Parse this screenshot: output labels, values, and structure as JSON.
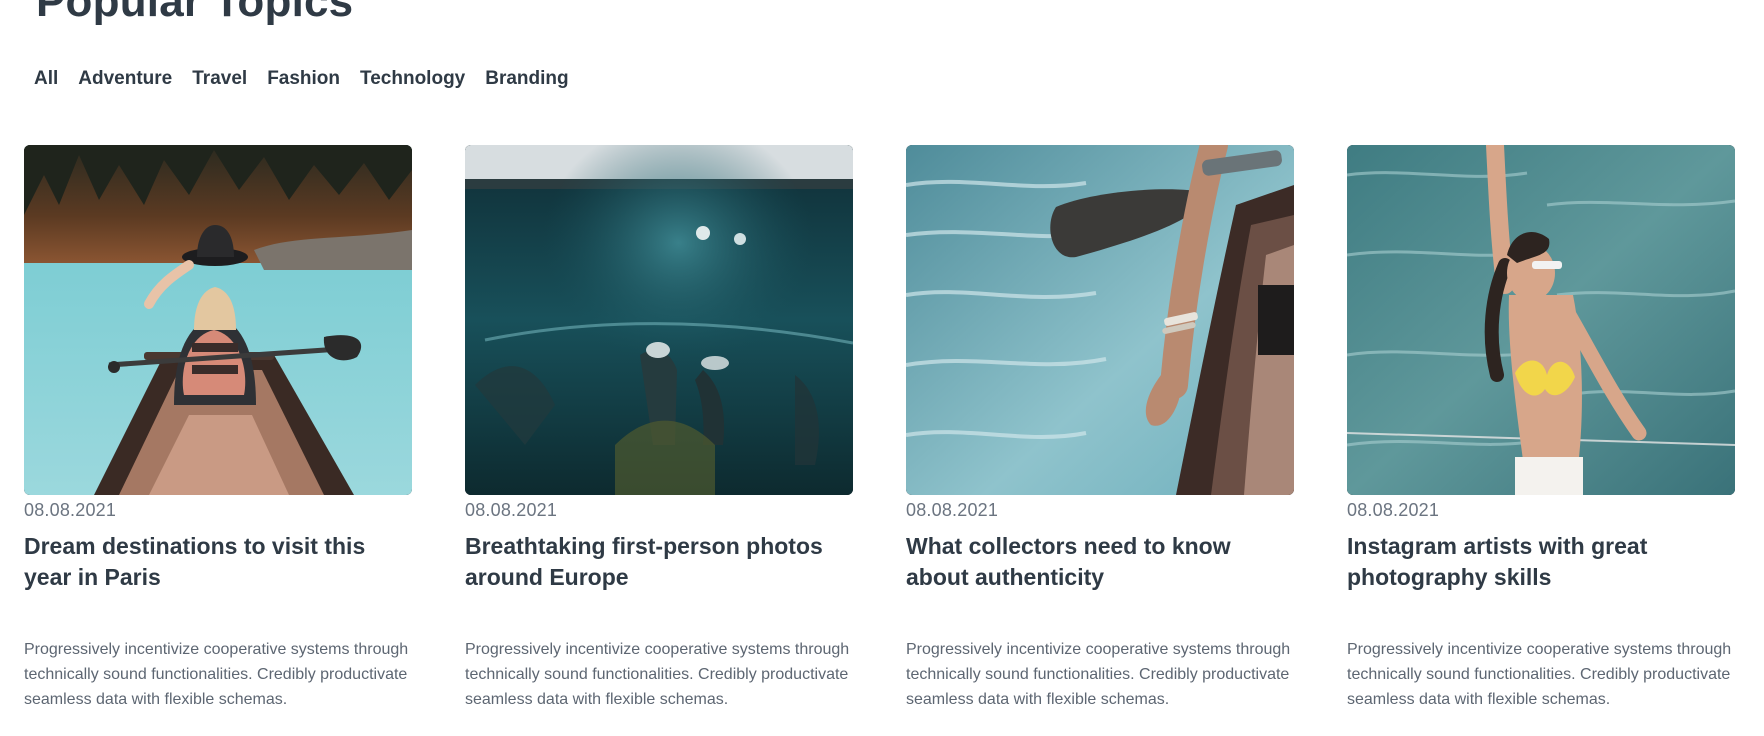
{
  "page": {
    "title": "Popular Topics"
  },
  "tabs": [
    {
      "label": "All"
    },
    {
      "label": "Adventure"
    },
    {
      "label": "Travel"
    },
    {
      "label": "Fashion"
    },
    {
      "label": "Technology"
    },
    {
      "label": "Branding"
    }
  ],
  "cards": [
    {
      "date": "08.08.2021",
      "title": "Dream destinations to visit this year in Paris",
      "excerpt": "Progressively incentivize cooperative systems through technically sound functionalities. Credibly productivate seamless data with flexible schemas.",
      "image": "canoe-lake-woman-with-hat"
    },
    {
      "date": "08.08.2021",
      "title": "Breathtaking first-person photos around Europe",
      "excerpt": "Progressively incentivize cooperative systems through technically sound functionalities. Credibly productivate seamless data with flexible schemas.",
      "image": "underwater-swimmers"
    },
    {
      "date": "08.08.2021",
      "title": "What collectors need to know about authenticity",
      "excerpt": "Progressively incentivize cooperative systems through technically sound functionalities. Credibly productivate seamless data with flexible schemas.",
      "image": "canoe-hand-in-water"
    },
    {
      "date": "08.08.2021",
      "title": "Instagram artists with great photography skills",
      "excerpt": "Progressively incentivize cooperative systems through technically sound functionalities. Credibly productivate seamless data with flexible schemas.",
      "image": "woman-on-boat-sea"
    }
  ],
  "colors": {
    "text_dark": "#2f3a45",
    "text_muted": "#5d6672",
    "date": "#6b7480",
    "background": "#ffffff"
  }
}
